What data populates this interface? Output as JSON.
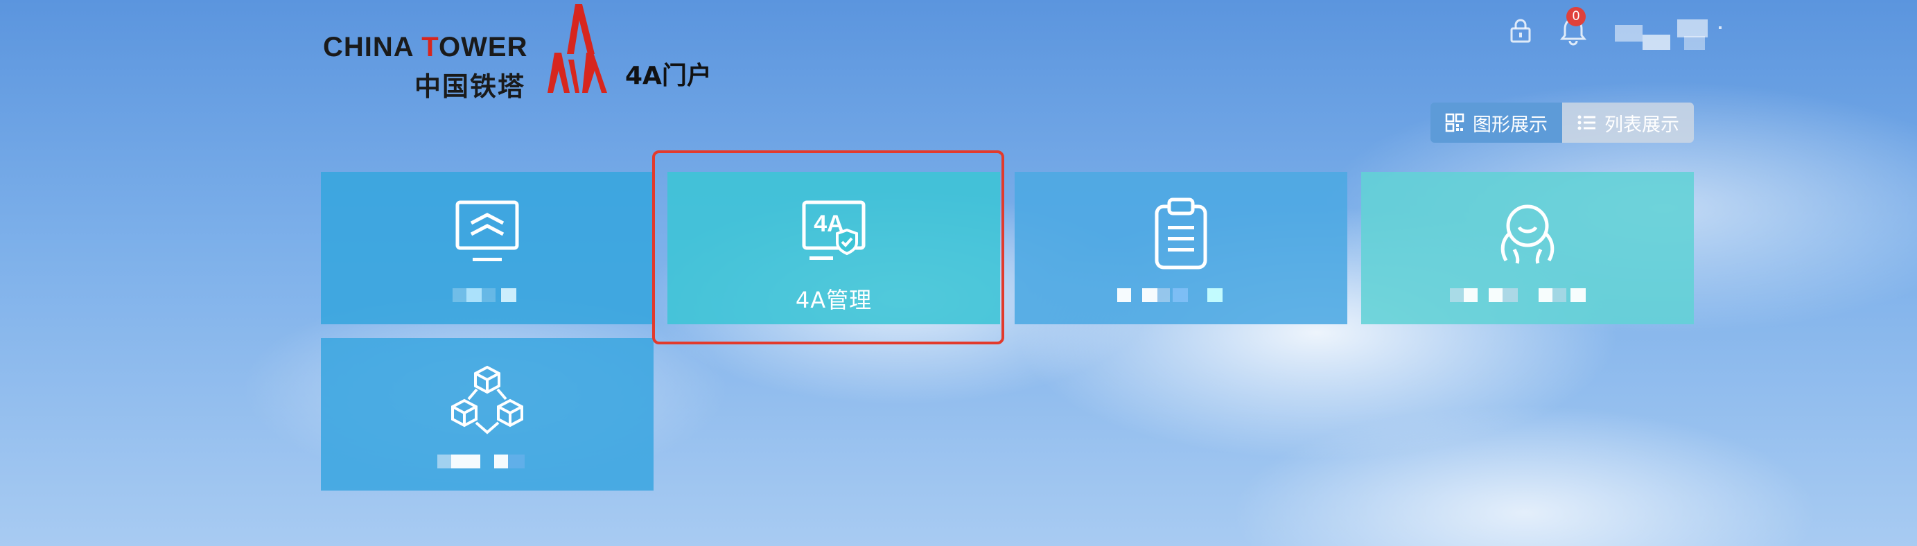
{
  "header": {
    "logo_en_part1": "CHINA ",
    "logo_en_red": "T",
    "logo_en_part2": "OWER",
    "logo_cn": "中国铁塔",
    "app_title": "4A门户",
    "notification_count": "0"
  },
  "view_toggle": {
    "grid_label": "图形展示",
    "list_label": "列表展示",
    "active": "grid"
  },
  "tiles": [
    {
      "icon": "monitor-wave-icon",
      "label": ""
    },
    {
      "icon": "4a-shield-monitor-icon",
      "label": "4A管理"
    },
    {
      "icon": "clipboard-icon",
      "label": ""
    },
    {
      "icon": "user-hands-icon",
      "label": ""
    },
    {
      "icon": "cubes-network-icon",
      "label": ""
    }
  ],
  "colors": {
    "brand_red": "#d7261e",
    "highlight_border": "#e23a2c",
    "badge": "#e0413b",
    "toggle_active": "#5d9bd8"
  }
}
